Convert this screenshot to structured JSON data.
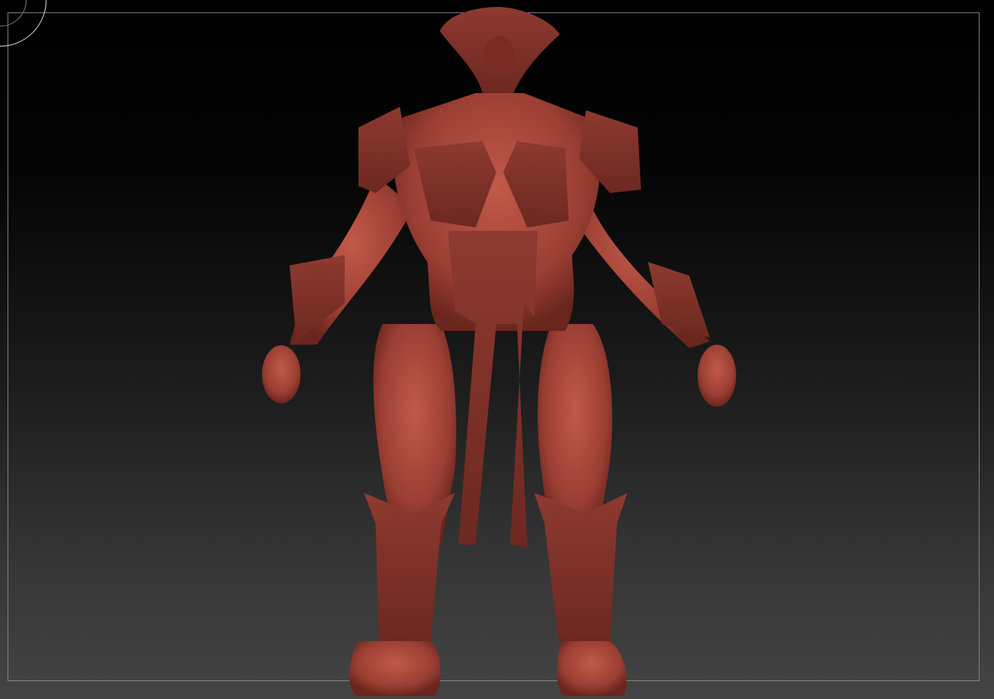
{
  "viewport": {
    "model_color": "#a8473b",
    "model_shadow": "#5e1f18",
    "model_highlight": "#d0715f",
    "frame_color": "#8a8a8a",
    "background_top": "#000000",
    "background_bottom": "#444444"
  }
}
